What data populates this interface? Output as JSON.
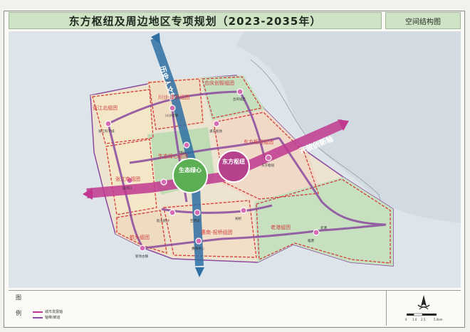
{
  "header": {
    "title": "东方枢纽及周边地区专项规划（2023-2035年）",
    "map_type": "空间结构图"
  },
  "axes": {
    "vertical": "历史人文轴",
    "horizontal": "开放创新轴"
  },
  "centers": {
    "eco": "生态绿心",
    "hub": "东方枢纽"
  },
  "clusters": [
    "张江北组团",
    "川沙-康桥组团",
    "合庆创智组团",
    "生态绿心组团",
    "东方枢纽组团",
    "张江南组团",
    "航头组团",
    "惠南-祝桥组团",
    "老港组团"
  ],
  "nodes": [
    "张江科学城",
    "川沙新镇",
    "合庆城区",
    "东方枢纽",
    "新场古镇",
    "惠南中心",
    "航头鹤沙",
    "祝桥",
    "临港",
    "浦东机场",
    "老港",
    "空港城",
    "绿心",
    "运河口"
  ],
  "legend": {
    "title1": "图",
    "title2": "例",
    "items": [
      "城市发展轴",
      "轴带/廊道"
    ]
  },
  "scale": {
    "ticks": [
      "0",
      "1.0",
      "2.5",
      "5.0km"
    ]
  },
  "colors": {
    "axis_blue": "#2e6fa3",
    "axis_magenta": "#c0388f",
    "cluster_border": "#d23d3d",
    "corridor": "#8a4a9f",
    "node_fill": "#d56bb2",
    "green_center": "#5cae52",
    "title_bg": "#cfe4c7"
  }
}
